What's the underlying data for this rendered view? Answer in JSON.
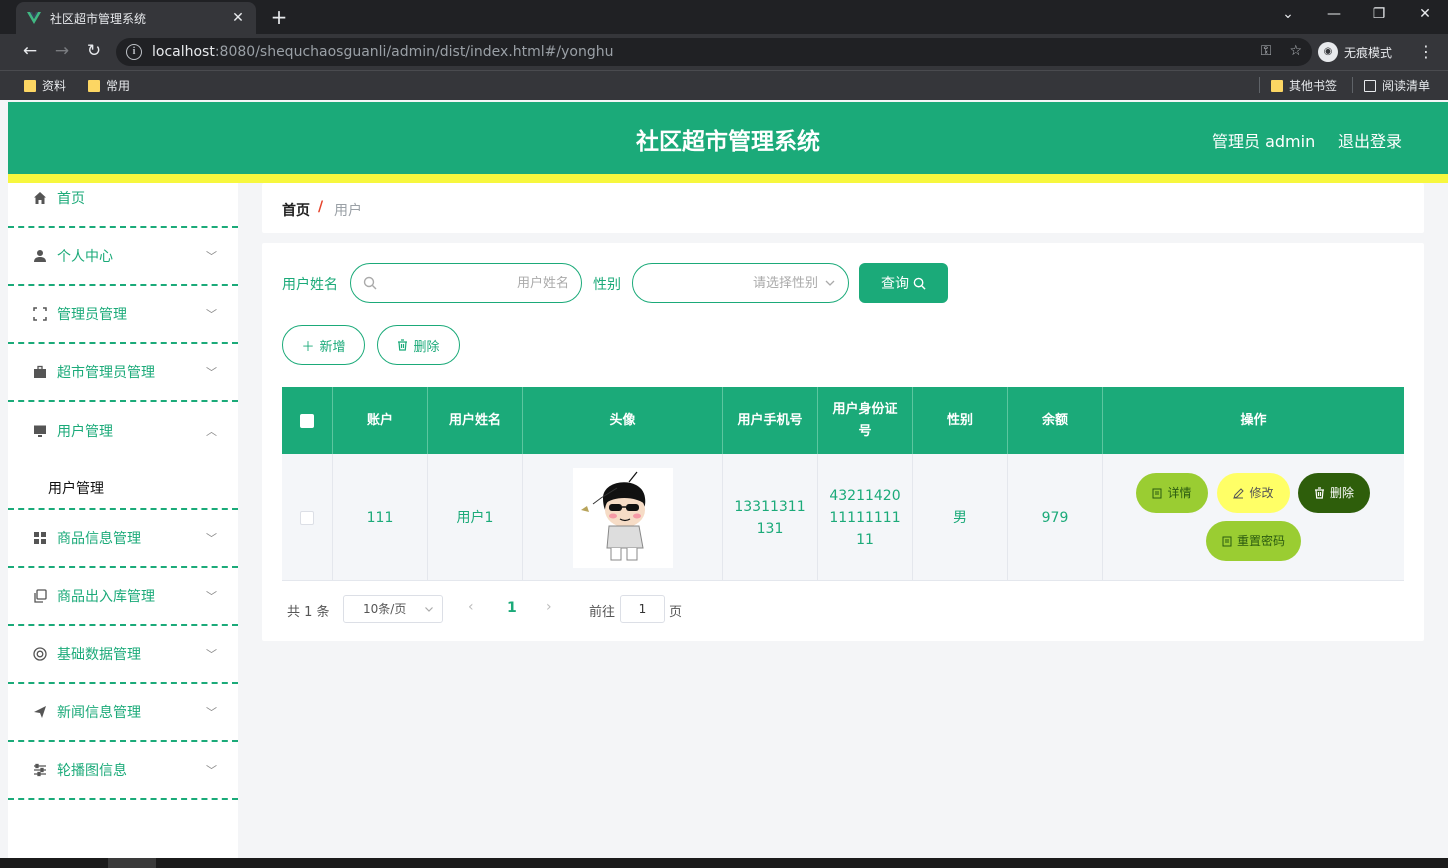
{
  "browser": {
    "tab_title": "社区超市管理系统",
    "url_host": "localhost",
    "url_path": ":8080/shequchaosguanli/admin/dist/index.html#/yonghu",
    "incognito_label": "无痕模式",
    "bookmarks": [
      "资料",
      "常用"
    ],
    "bookmarks_right": [
      "其他书签",
      "阅读清单"
    ]
  },
  "header": {
    "title": "社区超市管理系统",
    "user": "管理员 admin",
    "logout": "退出登录"
  },
  "sidebar": {
    "items": [
      {
        "label": "首页",
        "icon": "home-icon"
      },
      {
        "label": "个人中心",
        "icon": "user-icon"
      },
      {
        "label": "管理员管理",
        "icon": "fullscreen-icon"
      },
      {
        "label": "超市管理员管理",
        "icon": "briefcase-icon"
      },
      {
        "label": "用户管理",
        "icon": "monitor-icon"
      },
      {
        "label": "商品信息管理",
        "icon": "grid-icon"
      },
      {
        "label": "商品出入库管理",
        "icon": "copy-icon"
      },
      {
        "label": "基础数据管理",
        "icon": "lifebuoy-icon"
      },
      {
        "label": "新闻信息管理",
        "icon": "send-icon"
      },
      {
        "label": "轮播图信息",
        "icon": "sliders-icon"
      }
    ],
    "subitem": "用户管理"
  },
  "breadcrumb": {
    "home": "首页",
    "separator": "/",
    "current": "用户"
  },
  "search": {
    "name_label": "用户姓名",
    "name_placeholder": "用户姓名",
    "gender_label": "性别",
    "gender_placeholder": "请选择性别",
    "query_label": "查询"
  },
  "actions": {
    "add": "新增",
    "delete": "删除"
  },
  "table": {
    "headers": [
      "账户",
      "用户姓名",
      "头像",
      "用户手机号",
      "用户身份证号",
      "性别",
      "余额",
      "操作"
    ],
    "row": {
      "account": "111",
      "name": "用户1",
      "phone": "13311311131",
      "idcard": "432114201111111111",
      "gender": "男",
      "balance": "979"
    },
    "buttons": {
      "detail": "详情",
      "edit": "修改",
      "delete": "删除",
      "reset": "重置密码"
    }
  },
  "pagination": {
    "total": "共 1 条",
    "page_size": "10条/页",
    "current": "1",
    "goto": "前往",
    "goto_value": "1",
    "page_suffix": "页"
  },
  "colors": {
    "primary": "#1baa79",
    "yellow_bar": "#f7f73e",
    "detail_btn": "#9acd32",
    "edit_btn": "#ffff66",
    "delete_btn": "#2e5e0b"
  }
}
